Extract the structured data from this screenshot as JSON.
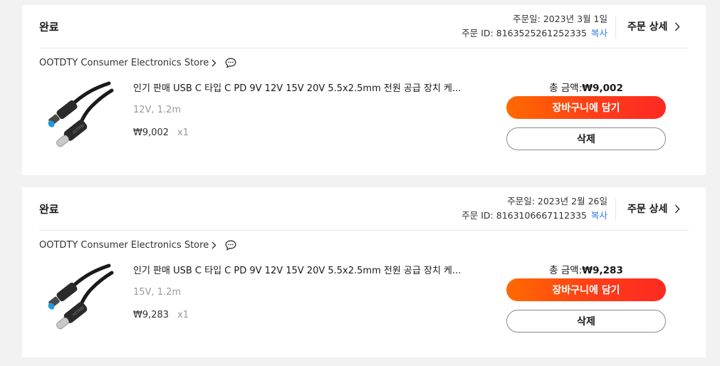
{
  "orders": [
    {
      "status": "완료",
      "order_date": "주문일: 2023년 3월 1일",
      "order_id": "주문 ID: 8163525261252335",
      "copy_label": "복사",
      "detail_label": "주문 상세",
      "store_name": "OOTDTY Consumer Electronics Store",
      "product_title": "인기 판매 USB C 타입 C PD 9V 12V 15V 20V 5.5x2.5mm 전원 공급 장치 케...",
      "variant": "12V, 1.2m",
      "price": "₩9,002",
      "quantity": "x1",
      "total_label": "총 금액:",
      "total_amount": "₩9,002",
      "cart_label": "장바구니에 담기",
      "delete_label": "삭제"
    },
    {
      "status": "완료",
      "order_date": "주문일: 2023년 2월 26일",
      "order_id": "주문 ID: 8163106667112335",
      "copy_label": "복사",
      "detail_label": "주문 상세",
      "store_name": "OOTDTY Consumer Electronics Store",
      "product_title": "인기 판매 USB C 타입 C PD 9V 12V 15V 20V 5.5x2.5mm 전원 공급 장치 케...",
      "variant": "15V, 1.2m",
      "price": "₩9,283",
      "quantity": "x1",
      "total_label": "총 금액:",
      "total_amount": "₩9,283",
      "cart_label": "장바구니에 담기",
      "delete_label": "삭제"
    }
  ],
  "icons": {
    "detail": "chevron-right-icon",
    "store": "chevron-right-icon",
    "chat": "chat-bubble-icon",
    "product": "usb-c-to-dc-cable-image"
  },
  "colors": {
    "accent_start": "#ff6a00",
    "accent_end": "#fd2a22",
    "link": "#2e7be6",
    "muted": "#999999",
    "background": "#f2f2f2"
  }
}
